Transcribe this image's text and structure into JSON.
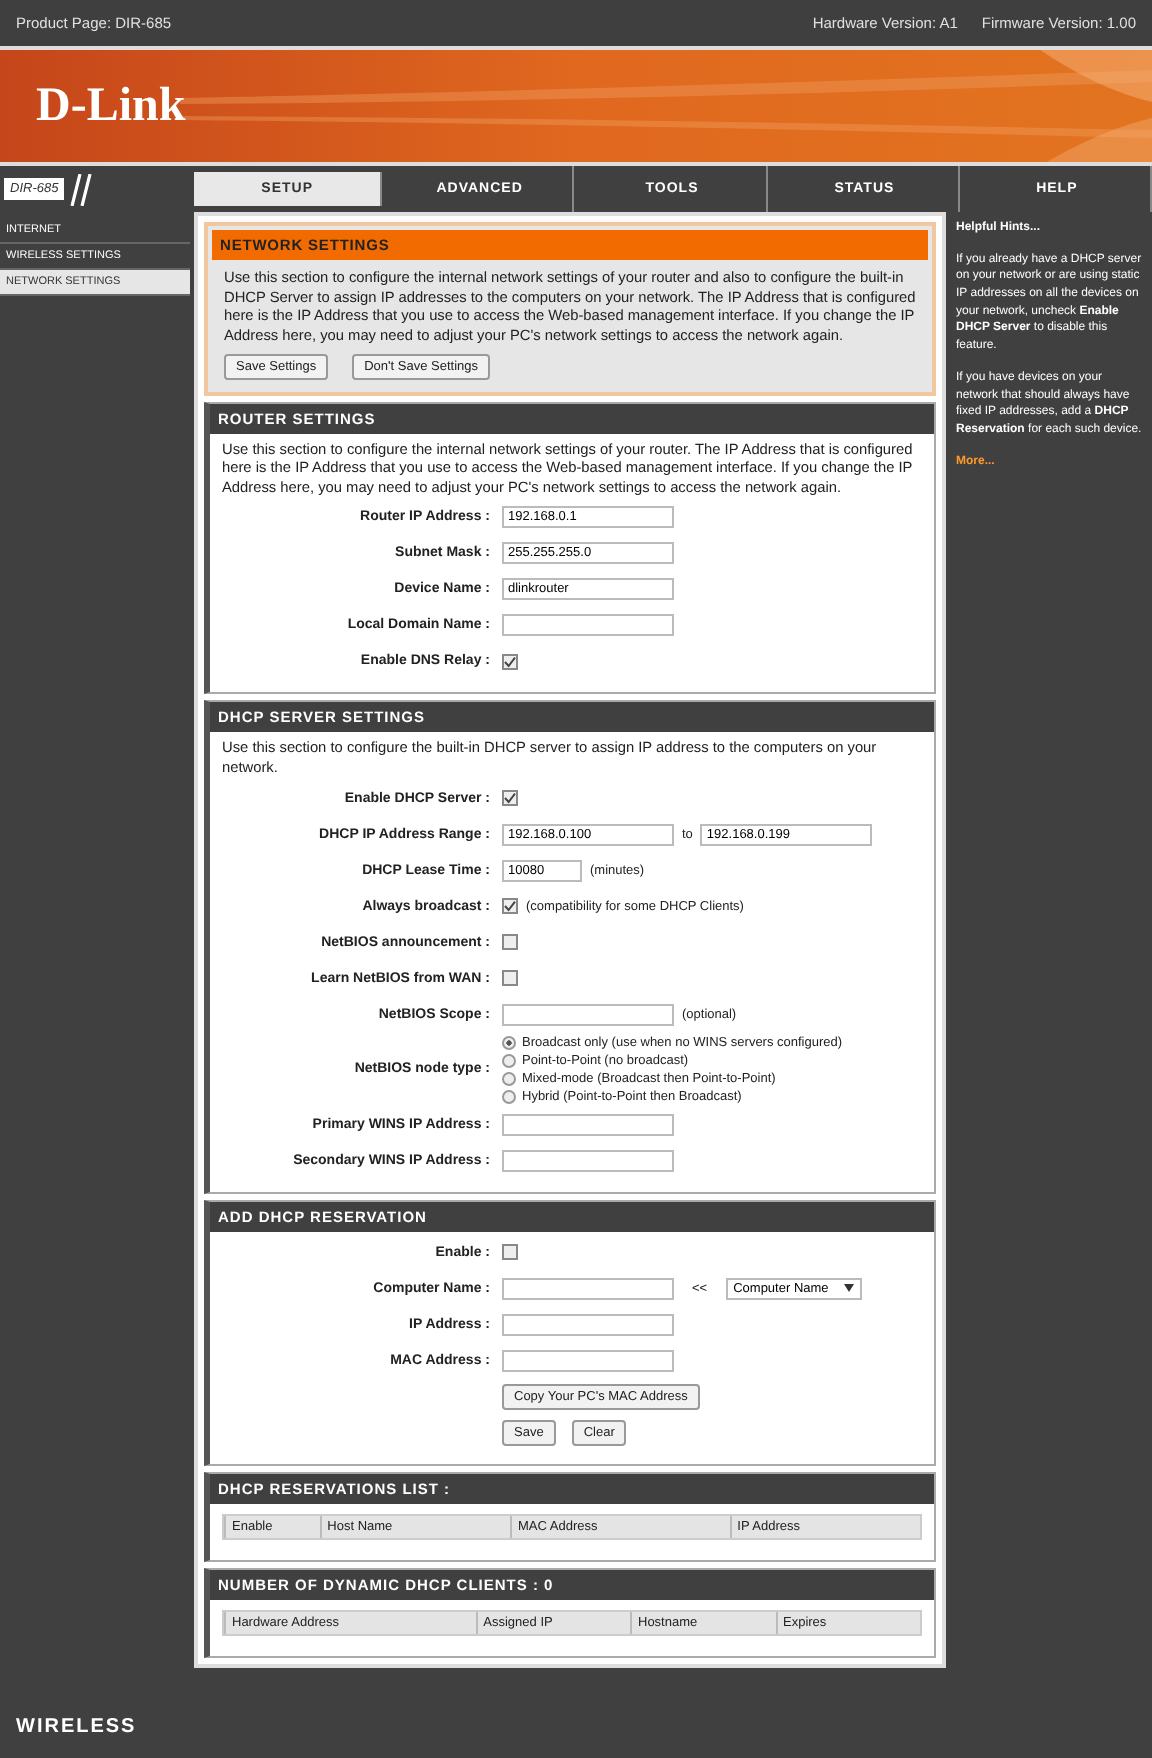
{
  "top_bar": {
    "product": "Product Page: DIR-685",
    "hardware": "Hardware Version: A1",
    "firmware": "Firmware Version: 1.00"
  },
  "logo": "D-Link",
  "model_tag": "DIR-685",
  "tabs": [
    {
      "label": "SETUP",
      "selected": true
    },
    {
      "label": "ADVANCED",
      "selected": false
    },
    {
      "label": "TOOLS",
      "selected": false
    },
    {
      "label": "STATUS",
      "selected": false
    },
    {
      "label": "HELP",
      "selected": false
    }
  ],
  "sidebar": {
    "items": [
      {
        "label": "INTERNET",
        "selected": false
      },
      {
        "label": "WIRELESS SETTINGS",
        "selected": false
      },
      {
        "label": "NETWORK SETTINGS",
        "selected": true
      }
    ]
  },
  "network_settings": {
    "title": "NETWORK SETTINGS",
    "description": "Use this section to configure the internal network settings of your router and also to configure the built-in DHCP Server to assign IP addresses to the computers on your network. The IP Address that is configured here is the IP Address that you use to access the Web-based management interface. If you change the IP Address here, you may need to adjust your PC's network settings to access the network again.",
    "buttons": [
      "Save Settings",
      "Don't Save Settings"
    ]
  },
  "router_settings": {
    "title": "ROUTER SETTINGS",
    "description": "Use this section to configure the internal network settings of your router. The IP Address that is configured here is the IP Address that you use to access the Web-based management interface. If you change the IP Address here, you may need to adjust your PC's network settings to access the network again.",
    "fields": [
      {
        "kind": "text",
        "label": "Router IP Address :",
        "value": "192.168.0.1"
      },
      {
        "kind": "text",
        "label": "Subnet Mask :",
        "value": "255.255.255.0"
      },
      {
        "kind": "text",
        "label": "Device Name :",
        "value": "dlinkrouter"
      },
      {
        "kind": "text",
        "label": "Local Domain Name :"
      },
      {
        "kind": "checkbox",
        "label": "Enable DNS Relay :",
        "checked": true
      }
    ]
  },
  "dhcp_server": {
    "title": "DHCP SERVER SETTINGS",
    "description": "Use this section to configure the built-in DHCP server to assign IP address to the computers on your network.",
    "fields": [
      {
        "kind": "checkbox",
        "label": "Enable DHCP Server :",
        "checked": true
      },
      {
        "kind": "range",
        "label": "DHCP IP Address Range :",
        "from": "192.168.0.100",
        "separator": "to",
        "to": "192.168.0.199"
      },
      {
        "kind": "short",
        "label": "DHCP Lease Time :",
        "value": "10080",
        "note": "(minutes)"
      },
      {
        "kind": "checkbox",
        "label": "Always broadcast :",
        "checked": true,
        "note": "(compatibility for some DHCP Clients)"
      },
      {
        "kind": "checkbox",
        "label": "NetBIOS announcement :",
        "checked": false
      },
      {
        "kind": "checkbox",
        "label": "Learn NetBIOS from WAN :",
        "checked": false
      },
      {
        "kind": "text",
        "label": "NetBIOS Scope :",
        "note": "(optional)"
      },
      {
        "kind": "radios",
        "label": "NetBIOS node type :",
        "options": [
          {
            "label": "Broadcast only (use when no WINS servers configured)",
            "selected": true
          },
          {
            "label": "Point-to-Point (no broadcast)",
            "selected": false
          },
          {
            "label": "Mixed-mode (Broadcast then Point-to-Point)",
            "selected": false
          },
          {
            "label": "Hybrid (Point-to-Point then Broadcast)",
            "selected": false
          }
        ]
      },
      {
        "kind": "text",
        "label": "Primary WINS IP Address :"
      },
      {
        "kind": "text",
        "label": "Secondary WINS IP Address :"
      }
    ]
  },
  "add_reservation": {
    "title": "ADD DHCP RESERVATION",
    "fields": [
      {
        "kind": "checkbox",
        "label": "Enable :",
        "checked": false
      },
      {
        "kind": "combo",
        "label": "Computer Name :",
        "arrow": "<<",
        "option": "Computer Name"
      },
      {
        "kind": "text",
        "label": "IP Address :"
      },
      {
        "kind": "text",
        "label": "MAC Address :"
      },
      {
        "kind": "button",
        "button": "Copy Your PC's MAC Address"
      },
      {
        "kind": "buttons",
        "buttons": [
          "Save",
          "Clear"
        ]
      }
    ]
  },
  "reservations_list": {
    "title": "DHCP RESERVATIONS LIST :",
    "columns": [
      "Enable",
      "Host Name",
      "MAC Address",
      "IP Address"
    ]
  },
  "dynamic_clients": {
    "title": "NUMBER OF DYNAMIC DHCP CLIENTS : 0",
    "columns": [
      "Hardware Address",
      "Assigned IP",
      "Hostname",
      "Expires"
    ]
  },
  "help": {
    "title": "Helpful Hints...",
    "paragraphs": [
      "If you already have a DHCP server on your network or are using static IP addresses on all the devices on your network, uncheck **Enable DHCP Server** to disable this feature.",
      "If you have devices on your network that should always have fixed IP addresses, add a **DHCP Reservation** for each such device."
    ],
    "link": "More..."
  },
  "footer": "WIRELESS"
}
